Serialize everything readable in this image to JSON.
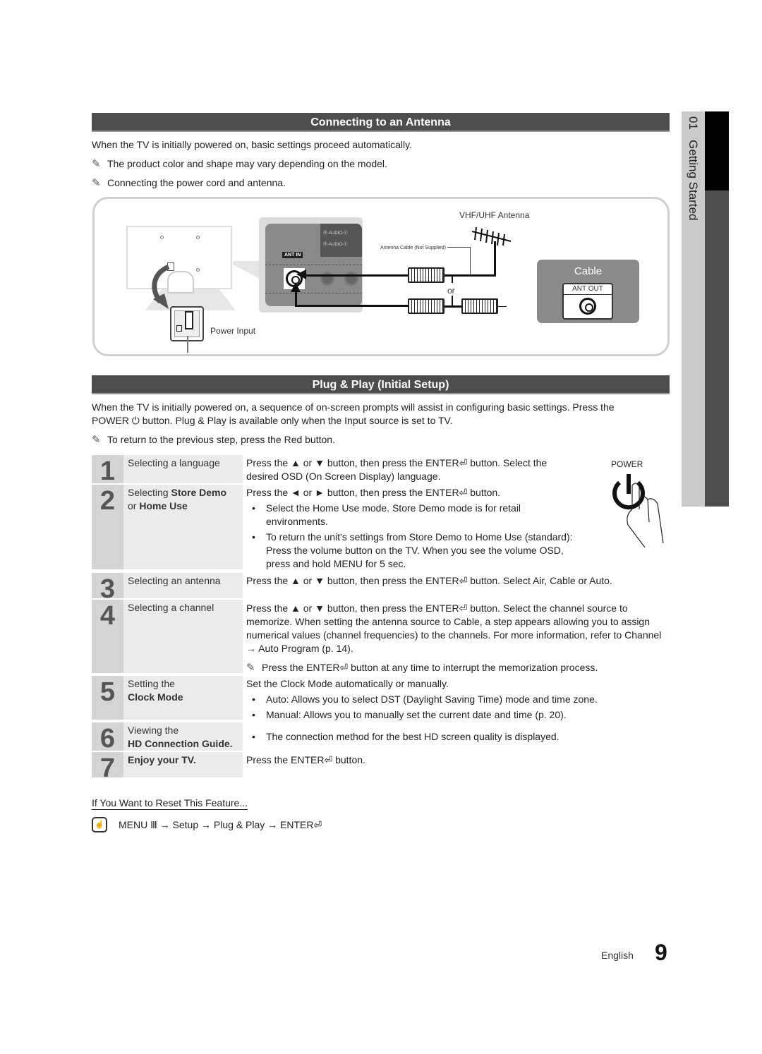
{
  "side_tab": {
    "chapter": "01",
    "title": "Getting Started"
  },
  "antenna_section": {
    "title": "Connecting to an Antenna",
    "intro": "When the TV is initially powered on, basic settings proceed automatically.",
    "notes": [
      "The product color and shape may vary depending on the model.",
      "Connecting the power cord and antenna."
    ],
    "diagram": {
      "power_input_label": "Power Input",
      "ant_in_label": "ANT IN",
      "audio_label_1": "Ⓡ-AUDIO-Ⓛ",
      "audio_label_2": "Ⓡ-AUDIO-Ⓛ",
      "antenna_label": "VHF/UHF Antenna",
      "cable_note": "Antenna Cable (Not Supplied)",
      "or_label": "or",
      "cable_box_title": "Cable",
      "ant_out_label": "ANT OUT"
    }
  },
  "plug_play_section": {
    "title": "Plug & Play (Initial Setup)",
    "intro_part1": "When the TV is initially powered on, a sequence of on-screen prompts will assist in configuring basic settings. Press the",
    "intro_power": "POWER",
    "intro_part2": "button.",
    "intro_plug_play": "Plug & Play",
    "intro_part3": "is available only when the",
    "intro_input": "Input",
    "intro_part4": "source is set to TV.",
    "note": "To return to the previous step, press the Red button.",
    "power_graphic_label": "POWER",
    "steps": [
      {
        "number": "1",
        "title": "Selecting a language",
        "desc": "Press the ▲ or ▼ button, then press the ENTER⏎ button. Select the desired OSD (On Screen Display) language."
      },
      {
        "number": "2",
        "title_prefix": "Selecting",
        "title_bold1": "Store Demo",
        "title_mid": "or",
        "title_bold2": "Home Use",
        "desc": "Press the ◄ or ► button, then press the ENTER⏎ button.",
        "bullets": [
          "Select the Home Use mode. Store Demo mode is for retail environments.",
          "To return the unit's settings from Store Demo to Home Use (standard): Press the volume button on the TV. When you see the volume OSD, press and hold MENU for 5 sec."
        ]
      },
      {
        "number": "3",
        "title": "Selecting an antenna",
        "desc": "Press the ▲ or ▼ button, then press the ENTER⏎ button. Select Air, Cable or Auto."
      },
      {
        "number": "4",
        "title": "Selecting a channel",
        "desc": "Press the ▲ or ▼ button, then press the ENTER⏎ button. Select the channel source to memorize. When setting the antenna source to Cable, a step appears allowing you to assign numerical values (channel frequencies) to the channels. For more information, refer to Channel → Auto Program (p. 14).",
        "note": "Press the ENTER⏎ button at any time to interrupt the memorization process."
      },
      {
        "number": "5",
        "title_line1": "Setting the",
        "title_line2": "Clock Mode",
        "desc": "Set the Clock Mode automatically or manually.",
        "bullets": [
          "Auto: Allows you to select DST (Daylight Saving Time) mode and time zone.",
          "Manual: Allows you to manually set the current date and time (p. 20)."
        ]
      },
      {
        "number": "6",
        "title_line1": "Viewing the",
        "title_line2": "HD Connection Guide.",
        "bullets": [
          "The connection method for the best HD screen quality is displayed."
        ]
      },
      {
        "number": "7",
        "title": "Enjoy your TV.",
        "desc": "Press the ENTER⏎ button."
      }
    ]
  },
  "reset": {
    "title": "If You Want to Reset This Feature...",
    "path": "MENU Ⅲ → Setup → Plug & Play → ENTER⏎"
  },
  "footer": {
    "language": "English",
    "page_number": "9"
  }
}
